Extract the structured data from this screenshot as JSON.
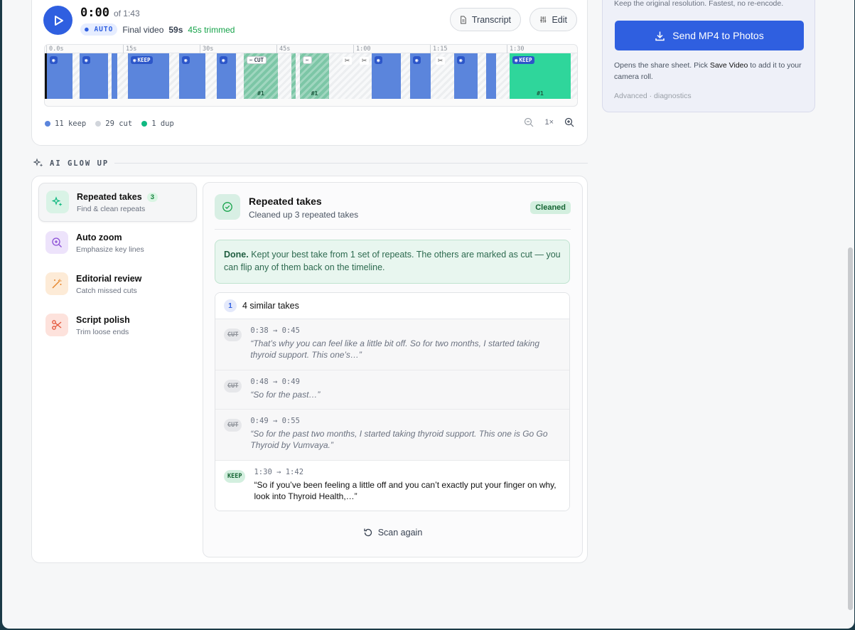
{
  "player": {
    "current_time": "0:00",
    "of_duration": "of 1:43",
    "auto_badge": "AUTO",
    "final_video_label": "Final video",
    "final_video_length": "59s",
    "trimmed_text": "45s trimmed",
    "transcript_button": "Transcript",
    "edit_button": "Edit"
  },
  "timeline": {
    "ruler_ticks": [
      "0.0s",
      "15s",
      "30s",
      "45s",
      "1:00",
      "1:15",
      "1:30"
    ],
    "keep_tag": "KEEP",
    "cut_tag": "CUT",
    "dup_labels": [
      "#1",
      "#1",
      "#1"
    ],
    "legend": [
      {
        "label": "11 keep",
        "color": "#5b85dc"
      },
      {
        "label": "29 cut",
        "color": "#d1d5db"
      },
      {
        "label": "1 dup",
        "color": "#10b981"
      }
    ],
    "zoom_level": "1×"
  },
  "export": {
    "hint": "Keep the original resolution. Fastest, no re-encode.",
    "send_button": "Send MP4 to Photos",
    "share_prefix": "Opens the share sheet. Pick",
    "share_strong": "Save Video",
    "share_suffix": "to add it to your camera roll.",
    "advanced_link": "Advanced · diagnostics"
  },
  "ai": {
    "section_title": "AI GLOW UP",
    "tools": [
      {
        "title": "Repeated takes",
        "subtitle": "Find & clean repeats",
        "count": "3",
        "icon": "sparkles-icon",
        "color": "#10b981",
        "bg": "#d9f3e6"
      },
      {
        "title": "Auto zoom",
        "subtitle": "Emphasize key lines",
        "icon": "zoom-in-icon",
        "color": "#8b4fd6",
        "bg": "#ede3fb"
      },
      {
        "title": "Editorial review",
        "subtitle": "Catch missed cuts",
        "icon": "magic-wand-icon",
        "color": "#e6862b",
        "bg": "#fdebd7"
      },
      {
        "title": "Script polish",
        "subtitle": "Trim loose ends",
        "icon": "scissors-icon",
        "color": "#e3553a",
        "bg": "#fde2dc"
      }
    ],
    "detail": {
      "title": "Repeated takes",
      "subtitle": "Cleaned up 3 repeated takes",
      "status": "Cleaned",
      "done_strong": "Done.",
      "done_text": "Kept your best take from 1 set of repeats. The others are marked as cut — you can flip any of them back on the timeline.",
      "group_number": "1",
      "group_label": "4 similar takes",
      "takes": [
        {
          "tag": "CUT",
          "range": "0:38 → 0:45",
          "quote": "“That’s why you can feel like a little bit off. So for two months, I started taking thyroid support. This one’s…”"
        },
        {
          "tag": "CUT",
          "range": "0:48 → 0:49",
          "quote": "“So for the past…”"
        },
        {
          "tag": "CUT",
          "range": "0:49 → 0:55",
          "quote": "“So for the past two months, I started taking thyroid support. This one is Go Go Thyroid by Vumvaya.”"
        },
        {
          "tag": "KEEP",
          "range": "1:30 → 1:42",
          "quote": "“So if you’ve been feeling a little off and you can’t exactly put your finger on why, look into Thyroid Health,…”"
        }
      ],
      "scan_again": "Scan again"
    }
  }
}
